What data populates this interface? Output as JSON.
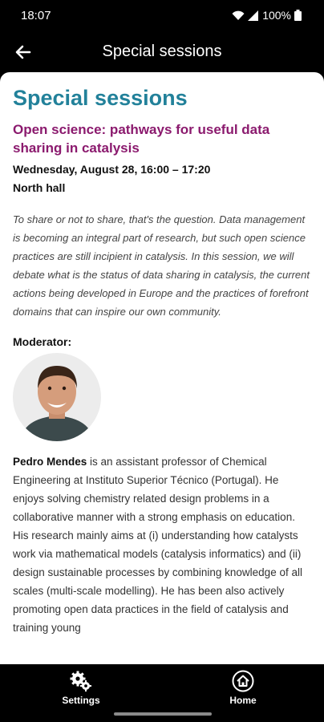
{
  "status": {
    "time": "18:07",
    "battery": "100%"
  },
  "app_bar": {
    "title": "Special sessions"
  },
  "page": {
    "title": "Special sessions",
    "session_title": "Open science: pathways for useful data sharing in catalysis",
    "date_time": "Wednesday, August 28, 16:00 – 17:20",
    "location": "North hall",
    "abstract": "To share or not to share, that's the question. Data management is becoming an integral part of research, but such open science practices are still incipient in catalysis. In this session, we will debate what is the status of data sharing in catalysis, the current actions being developed in Europe and the practices of forefront domains that can inspire our own community.",
    "moderator_label": "Moderator:",
    "moderator_name": "Pedro Mendes",
    "moderator_bio": " is an assistant professor of Chemical Engineering at Instituto Superior Técnico (Portugal). He enjoys solving chemistry related design problems in a collaborative manner with a strong emphasis on education. His research mainly aims at (i) understanding how catalysts work via mathematical models (catalysis informatics) and (ii) design sustainable processes by combining knowledge of all scales (multi-scale modelling). He has been also actively promoting open data practices in the field of catalysis and training young"
  },
  "nav": {
    "settings": "Settings",
    "home": "Home"
  },
  "colors": {
    "title": "#22819a",
    "session": "#8b1a6e"
  }
}
